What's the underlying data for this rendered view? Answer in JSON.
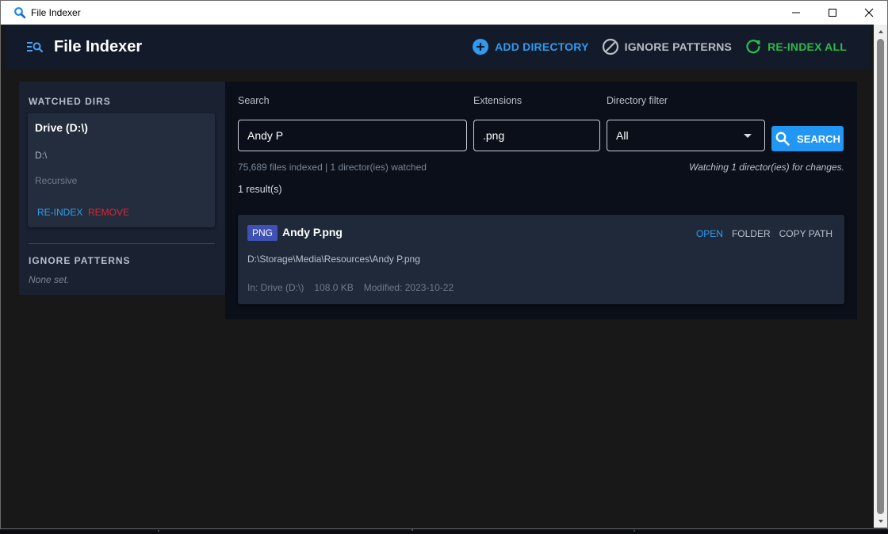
{
  "window": {
    "title": "File Indexer"
  },
  "appbar": {
    "title": "File Indexer",
    "add_directory_label": "ADD DIRECTORY",
    "ignore_patterns_label": "IGNORE PATTERNS",
    "reindex_all_label": "RE-INDEX ALL"
  },
  "sidebar": {
    "watched_title": "WATCHED DIRS",
    "directories": [
      {
        "name": "Drive (D:\\)",
        "path": "D:\\",
        "mode": "Recursive",
        "reindex_label": "RE-INDEX",
        "remove_label": "REMOVE"
      }
    ],
    "ignore_title": "IGNORE PATTERNS",
    "ignore_empty": "None set."
  },
  "search": {
    "query_label": "Search",
    "query_value": "Andy P",
    "extensions_label": "Extensions",
    "extensions_value": ".png",
    "directory_filter_label": "Directory filter",
    "directory_filter_value": "All",
    "search_button_label": "SEARCH",
    "stats": "75,689 files indexed | 1 director(ies) watched",
    "watching": "Watching 1 director(ies) for changes.",
    "result_count": "1 result(s)"
  },
  "results": [
    {
      "badge": "PNG",
      "name": "Andy P.png",
      "path": "D:\\Storage\\Media\\Resources\\Andy P.png",
      "location": "In: Drive (D:\\)",
      "size": "108.0 KB",
      "modified": "Modified: 2023-10-22",
      "open_label": "OPEN",
      "folder_label": "FOLDER",
      "copy_label": "COPY PATH"
    }
  ],
  "colors": {
    "accent": "#2196f3",
    "success": "#2dbb4a",
    "danger": "#e0242d",
    "badge": "#3f51b5"
  }
}
